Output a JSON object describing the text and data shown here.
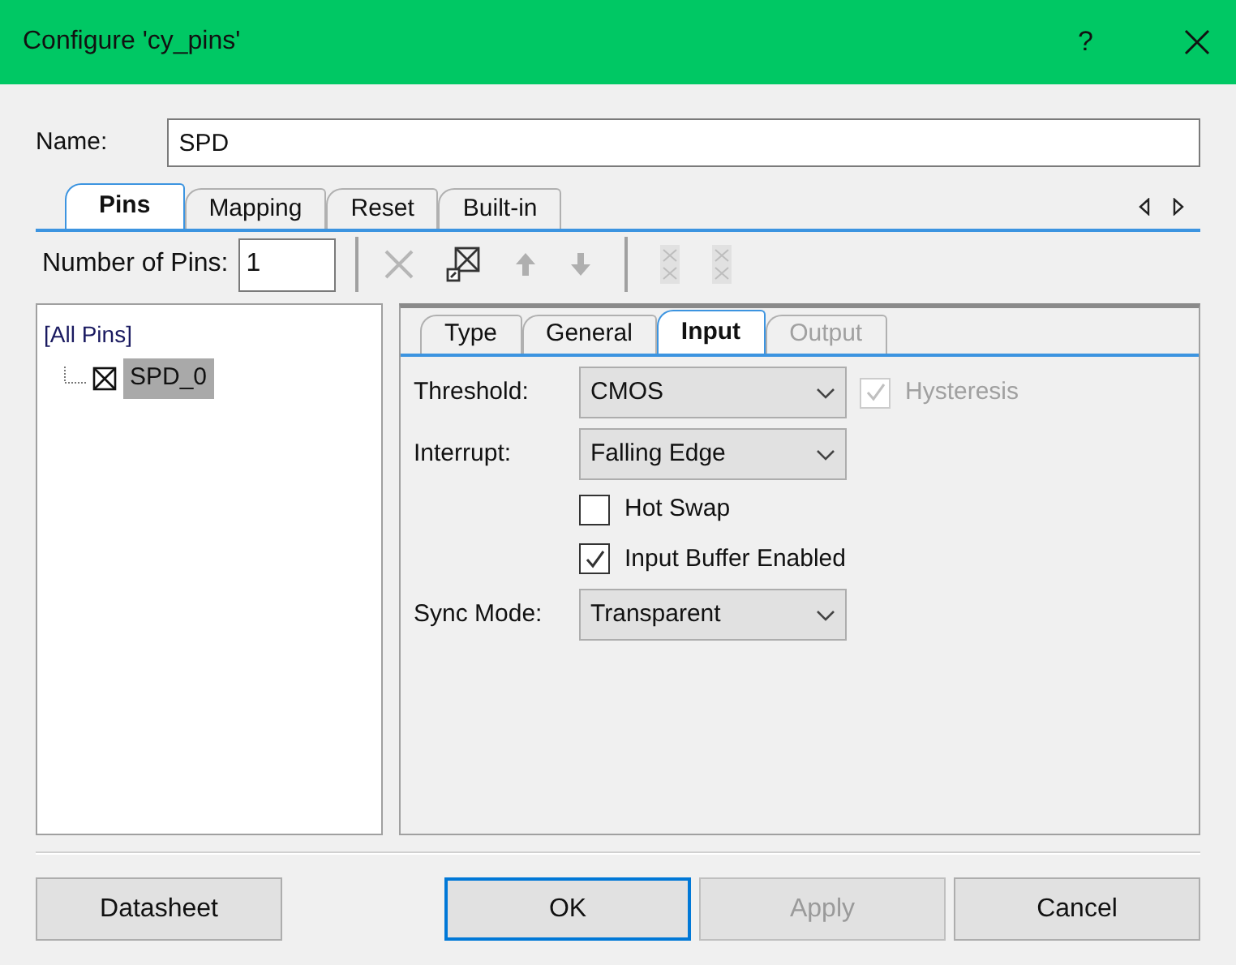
{
  "window": {
    "title": "Configure 'cy_pins'",
    "help": "?"
  },
  "name": {
    "label": "Name:",
    "value": "SPD"
  },
  "tabs": [
    {
      "label": "Pins",
      "selected": true
    },
    {
      "label": "Mapping",
      "selected": false
    },
    {
      "label": "Reset",
      "selected": false
    },
    {
      "label": "Built-in",
      "selected": false
    }
  ],
  "number_of_pins": {
    "label": "Number of Pins:",
    "value": "1"
  },
  "toolbar": [
    {
      "kind": "delete",
      "disabled": true
    },
    {
      "kind": "swap",
      "disabled": false
    },
    {
      "kind": "up",
      "disabled": true
    },
    {
      "kind": "down",
      "disabled": true
    },
    {
      "kind": "separator"
    },
    {
      "kind": "pair",
      "disabled": true
    },
    {
      "kind": "pair",
      "disabled": true
    }
  ],
  "tree": {
    "label": "[All Pins]",
    "children": [
      {
        "label": "SPD_0",
        "selected": true
      }
    ]
  },
  "subtabs": [
    {
      "label": "Type",
      "selected": false,
      "disabled": false
    },
    {
      "label": "General",
      "selected": false,
      "disabled": false
    },
    {
      "label": "Input",
      "selected": true,
      "disabled": false
    },
    {
      "label": "Output",
      "selected": false,
      "disabled": true
    }
  ],
  "threshold": {
    "label": "Threshold:",
    "value": "CMOS"
  },
  "hysteresis": {
    "label": "Hysteresis",
    "checked": true,
    "disabled": true
  },
  "interrupt": {
    "label": "Interrupt:",
    "value": "Falling Edge"
  },
  "hot_swap": {
    "label": "Hot Swap",
    "checked": false,
    "disabled": false
  },
  "input_buffer": {
    "label": "Input Buffer Enabled",
    "checked": true,
    "disabled": false
  },
  "sync_mode": {
    "label": "Sync Mode:",
    "value": "Transparent"
  },
  "buttons": [
    {
      "label": "Datasheet",
      "kind": "normal",
      "disabled": false
    },
    {
      "label": "OK",
      "kind": "default",
      "disabled": false
    },
    {
      "label": "Apply",
      "kind": "normal",
      "disabled": true
    },
    {
      "label": "Cancel",
      "kind": "normal",
      "disabled": false
    }
  ]
}
